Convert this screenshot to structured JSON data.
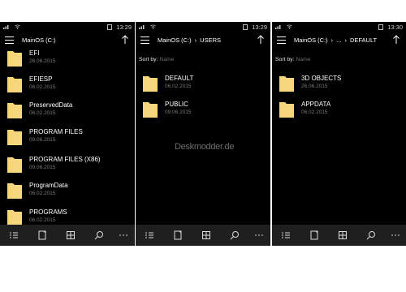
{
  "colors": {
    "background": "#000000",
    "folder": "#f6d77d",
    "text": "#ffffff",
    "secondary_text": "#7a7a7a",
    "bottom_bar": "#1f1f1f"
  },
  "watermark": "Deskmodder.de",
  "screens": [
    {
      "status": {
        "time": "13:29"
      },
      "path": [
        "MainOS (C:)"
      ],
      "items": [
        {
          "name": "EFI",
          "date": "26.06.2015"
        },
        {
          "name": "EFIESP",
          "date": "06.02.2015"
        },
        {
          "name": "PreservedData",
          "date": "06.02.2015"
        },
        {
          "name": "PROGRAM FILES",
          "date": "09.06.2015"
        },
        {
          "name": "PROGRAM FILES (X86)",
          "date": "09.06.2015"
        },
        {
          "name": "ProgramData",
          "date": "06.02.2015"
        },
        {
          "name": "PROGRAMS",
          "date": "06.02.2015"
        }
      ],
      "bottom_icons": [
        "select-icon",
        "new-icon",
        "view-icon",
        "search-icon",
        "more-icon"
      ]
    },
    {
      "status": {
        "time": "13:29"
      },
      "path": [
        "MainOS (C:)",
        "›",
        "USERS"
      ],
      "sort": {
        "label": "Sort by:",
        "value": "Name"
      },
      "items": [
        {
          "name": "DEFAULT",
          "date": "06.02.2015"
        },
        {
          "name": "PUBLIC",
          "date": "09.06.2015"
        }
      ],
      "bottom_icons": [
        "select-icon",
        "new-icon",
        "view-icon",
        "search-icon",
        "more-icon"
      ]
    },
    {
      "status": {
        "time": "13:30"
      },
      "path": [
        "MainOS (C:)",
        "›",
        "...",
        "›",
        "DEFAULT"
      ],
      "sort": {
        "label": "Sort by:",
        "value": "Name"
      },
      "items": [
        {
          "name": "3D OBJECTS",
          "date": "26.06.2015"
        },
        {
          "name": "APPDATA",
          "date": "06.02.2015"
        }
      ],
      "bottom_icons": [
        "select-icon",
        "new-icon",
        "view-icon",
        "search-icon",
        "more-icon"
      ]
    }
  ]
}
